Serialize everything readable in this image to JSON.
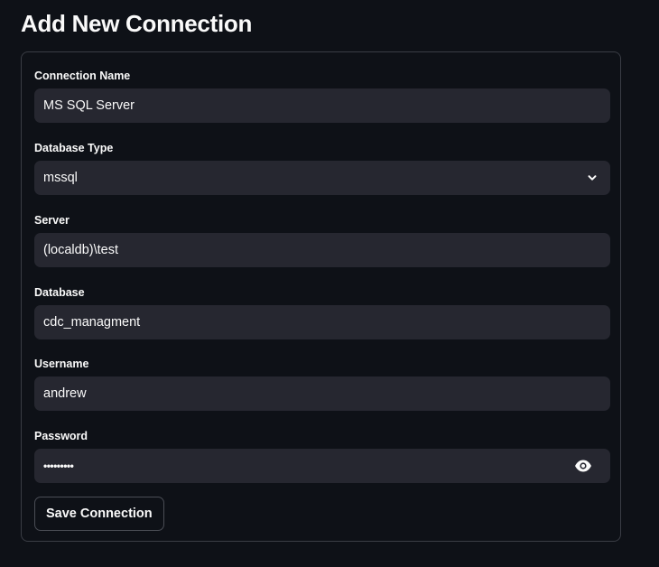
{
  "page": {
    "title": "Add New Connection"
  },
  "form": {
    "fields": [
      {
        "label": "Connection Name",
        "value": "MS SQL Server",
        "type": "text"
      },
      {
        "label": "Database Type",
        "value": "mssql",
        "type": "select"
      },
      {
        "label": "Server",
        "value": "(localdb)\\test",
        "type": "text"
      },
      {
        "label": "Database",
        "value": "cdc_managment",
        "type": "text"
      },
      {
        "label": "Username",
        "value": "andrew",
        "type": "text"
      },
      {
        "label": "Password",
        "value": "•••••••••",
        "type": "password"
      }
    ],
    "submit_label": "Save Connection"
  },
  "icons": {
    "select_chevron": "chevron-down-icon",
    "password_toggle": "eye-icon"
  },
  "colors": {
    "background": "#0e1117",
    "input_background": "#262730",
    "card_border": "#3a3d45",
    "text": "#fafafa"
  }
}
